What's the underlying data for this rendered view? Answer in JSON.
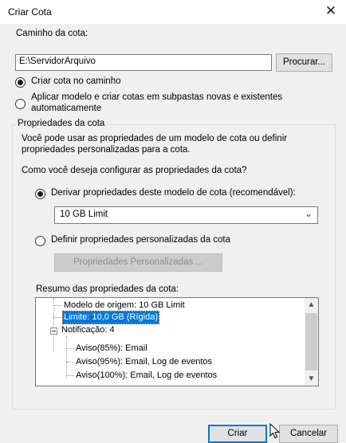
{
  "window": {
    "title": "Criar Cota",
    "close_glyph": "✕"
  },
  "path": {
    "label": "Caminho da cota:",
    "value": "E:\\ServidorArquivo",
    "browse_label": "Procurar..."
  },
  "options": {
    "create_on_path": "Criar cota no caminho",
    "apply_template_line1": "Aplicar modelo e criar cotas em subpastas novas e existentes",
    "apply_template_line2": "automaticamente",
    "create_on_path_selected": true
  },
  "properties": {
    "legend": "Propriedades da cota",
    "description_line1": "Você pode usar as propriedades de um modelo de cota ou definir",
    "description_line2": "propriedades personalizadas para a cota.",
    "question": "Como você deseja configurar as propriedades da cota?",
    "derive_label": "Derivar propriedades deste modelo de cota (recomendável):",
    "derive_selected": true,
    "template_selected": "10 GB Limit",
    "custom_label": "Definir propriedades personalizadas da cota",
    "custom_button": "Propriedades Personalizadas ...",
    "summary_label": "Resumo das propriedades da cota:"
  },
  "summary_tree": [
    "Modelo de origem: 10 GB Limit",
    "Limite: 10,0 GB (Rígida)",
    "Notificação: 4",
    "Aviso(85%): Email",
    "Aviso(95%): Email, Log de eventos",
    "Aviso(100%): Email, Log de eventos"
  ],
  "footer": {
    "create_label": "Criar",
    "cancel_label": "Cancelar"
  }
}
